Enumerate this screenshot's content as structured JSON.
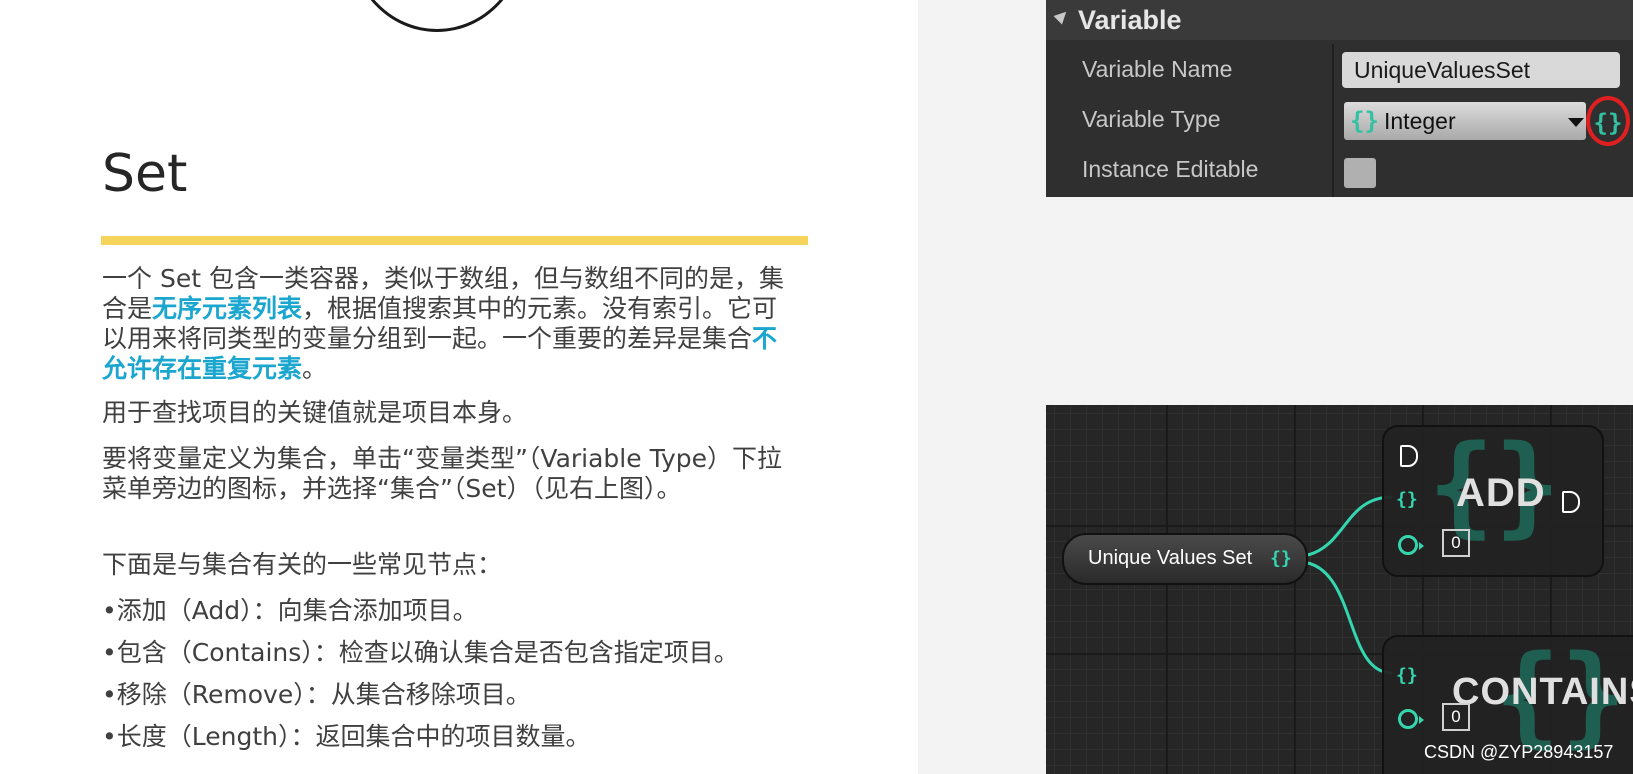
{
  "slide": {
    "title": "Set",
    "para1_a": "一个 Set 包含一类容器，类似于数组，但与数组不同的是，集合是",
    "para1_hl1": "无序元素列表",
    "para1_b": "，根据值搜索其中的元素。没有索引。它可以用来将同类型的变量分组到一起。一个重要的差异是集合",
    "para1_hl2": "不允许存在重复元素",
    "para1_c": "。",
    "para2": "用于查找项目的关键值就是项目本身。",
    "para3": "要将变量定义为集合，单击“变量类型”（Variable Type）下拉菜单旁边的图标，并选择“集合”（Set）（见右上图）。",
    "para4": "下面是与集合有关的一些常见节点：",
    "bullets": [
      "•添加（Add）：向集合添加项目。",
      "•包含（Contains）：检查以确认集合是否包含指定项目。",
      "•移除（Remove）：从集合移除项目。",
      "•长度（Length）：返回集合中的项目数量。"
    ],
    "accent_color": "#f6d45b",
    "highlight_color": "#1ba6cf"
  },
  "details_panel": {
    "section_title": "Variable",
    "rows": [
      {
        "label": "Variable Name",
        "value": "UniqueValuesSet"
      },
      {
        "label": "Variable Type",
        "value": "Integer"
      },
      {
        "label": "Instance Editable",
        "value": ""
      }
    ],
    "type_icon": "{}",
    "container_icon": "{}"
  },
  "blueprint": {
    "variable_node": "Unique Values Set",
    "set_pin": "{}",
    "add_node": {
      "title": "ADD",
      "set_pin": "{}",
      "int_default": "0"
    },
    "contains_node": {
      "title": "CONTAINS",
      "set_pin": "{}",
      "int_default": "0"
    },
    "pin_color": "#33d6ae"
  },
  "watermark": "CSDN @ZYP28943157"
}
